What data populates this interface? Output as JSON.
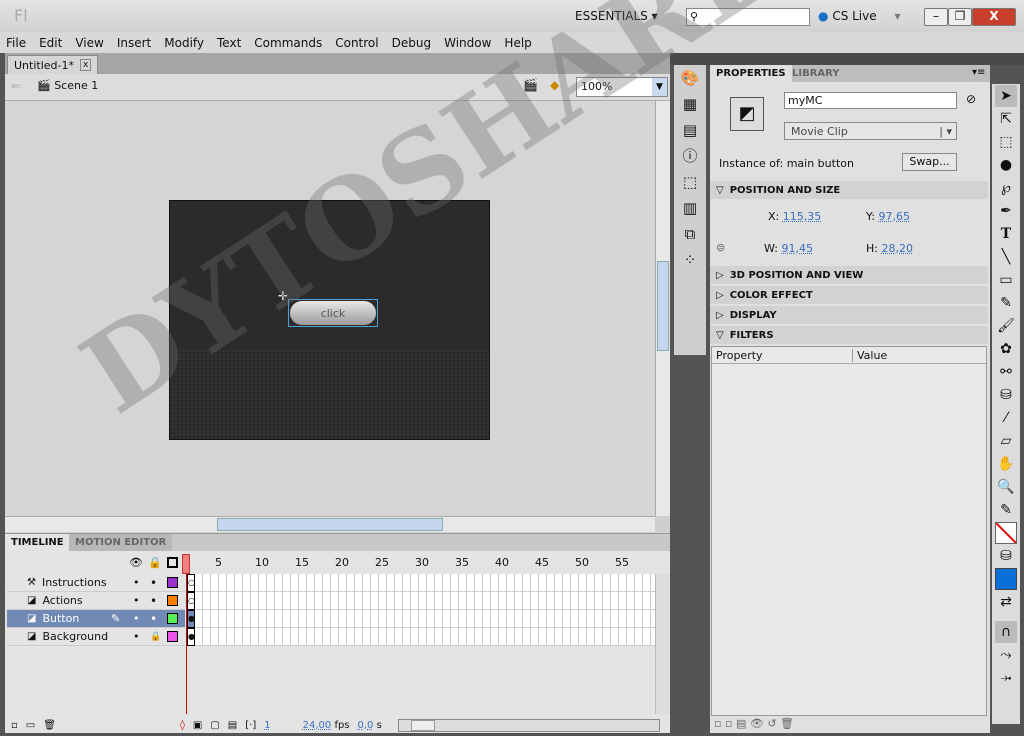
{
  "app": {
    "logo": "Fl",
    "workspace": "ESSENTIALS",
    "search_placeholder": "",
    "cs_live": "CS Live"
  },
  "menu": [
    "File",
    "Edit",
    "View",
    "Insert",
    "Modify",
    "Text",
    "Commands",
    "Control",
    "Debug",
    "Window",
    "Help"
  ],
  "document": {
    "tab": "Untitled-1*",
    "scene": "Scene 1",
    "zoom": "100%",
    "button_label": "click"
  },
  "timeline": {
    "tabs": [
      "TIMELINE",
      "MOTION EDITOR"
    ],
    "frame_numbers": [
      "5",
      "10",
      "15",
      "20",
      "25",
      "30",
      "35",
      "40",
      "45",
      "50",
      "55"
    ],
    "layers": [
      {
        "name": "Instructions",
        "color": "#9933cc"
      },
      {
        "name": "Actions",
        "color": "#ff8000"
      },
      {
        "name": "Button",
        "color": "#55ee55"
      },
      {
        "name": "Background",
        "color": "#ee55ee"
      }
    ],
    "current_frame": "1",
    "fps": "24,00",
    "fps_unit": "fps",
    "time": "0,0",
    "time_unit": "s"
  },
  "properties": {
    "tabs": [
      "PROPERTIES",
      "LIBRARY"
    ],
    "instance_name": "myMC",
    "type": "Movie Clip",
    "instance_of_label": "Instance of:",
    "instance_of": "main button",
    "swap": "Swap...",
    "sections": {
      "pos": "POSITION AND SIZE",
      "3d": "3D POSITION AND VIEW",
      "color": "COLOR EFFECT",
      "display": "DISPLAY",
      "filters": "FILTERS"
    },
    "x_label": "X:",
    "x": "115,35",
    "y_label": "Y:",
    "y": "97,65",
    "w_label": "W:",
    "w": "91,45",
    "h_label": "H:",
    "h": "28,20",
    "filter_cols": [
      "Property",
      "Value"
    ]
  },
  "watermark": "DYTOSHARETM"
}
